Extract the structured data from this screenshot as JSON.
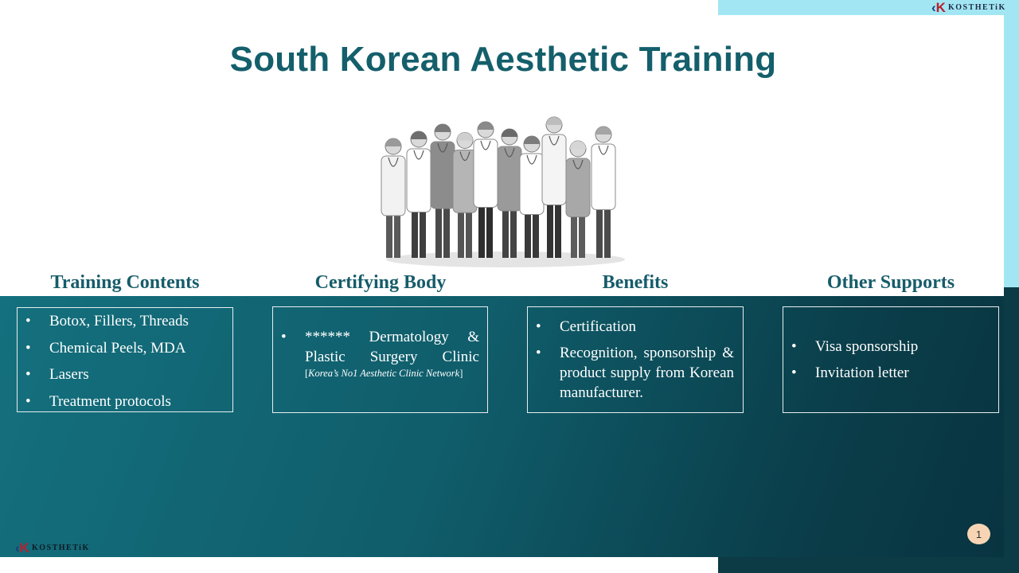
{
  "brand": {
    "name": "KOSTHETiK",
    "mark_red": "K",
    "mark_blue": "‹"
  },
  "slide": {
    "title": "South Korean Aesthetic Training",
    "page_number": "1"
  },
  "columns": [
    {
      "heading": "Training Contents",
      "items": [
        "Botox, Fillers, Threads",
        "Chemical Peels, MDA",
        "Lasers",
        "Treatment  protocols"
      ]
    },
    {
      "heading": "Certifying Body",
      "item_main": "****** Dermatology & Plastic Surgery Clinic",
      "note_open": "[",
      "note_italic": "Korea’s No1 Aesthetic Clinic Network",
      "note_close": "]"
    },
    {
      "heading": "Benefits",
      "items": [
        "Certification",
        "Recognition, sponsorship & product supply from Korean manufacturer."
      ]
    },
    {
      "heading": "Other Supports",
      "items": [
        "Visa sponsorship",
        "Invitation letter"
      ]
    }
  ],
  "colors": {
    "title": "#145f6b",
    "accent_light": "#a3e6f3",
    "accent_dark": "#0c3a45",
    "panel_start": "#14707e",
    "panel_end": "#083440",
    "badge": "#f7d5b4"
  },
  "illustration": {
    "icon": "medical-team-illustration"
  }
}
